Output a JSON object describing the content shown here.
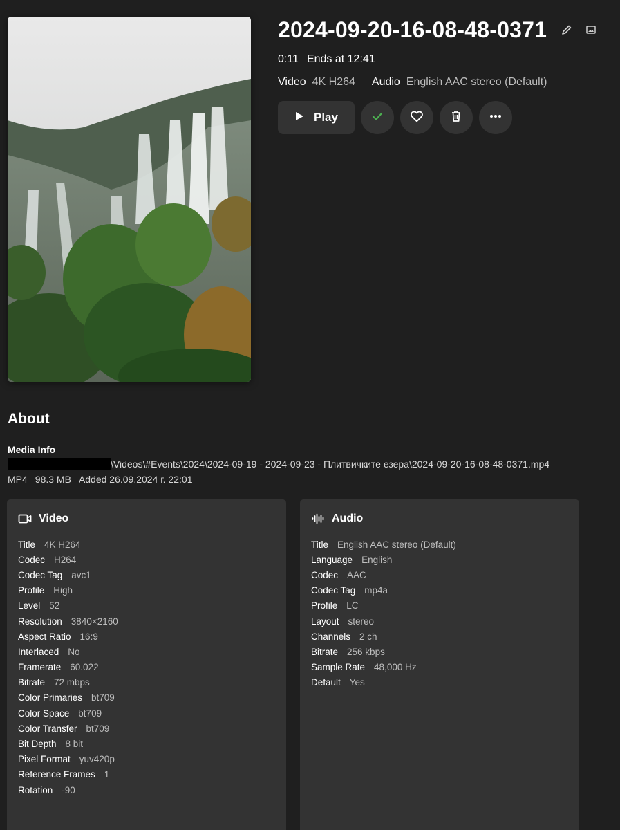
{
  "item": {
    "title": "2024-09-20-16-08-48-0371",
    "duration": "0:11",
    "ends_at": "Ends at 12:41",
    "video_label": "Video",
    "video_value": "4K H264",
    "audio_label": "Audio",
    "audio_value": "English AAC stereo (Default)"
  },
  "actions": {
    "play_label": "Play"
  },
  "icons": {
    "edit": "pencil-icon",
    "image": "image-icon",
    "play": "play-icon",
    "played": "check-icon",
    "favorite": "heart-icon",
    "delete": "trash-icon",
    "more": "more-icon",
    "video": "video-camera-icon",
    "audio": "audio-waveform-icon"
  },
  "colors": {
    "background": "#1f1f1f",
    "surface": "#333333",
    "check": "#4caf50",
    "muted_text": "#bdbdbd"
  },
  "about": {
    "title": "About",
    "media_info_heading": "Media Info",
    "path": "\\Videos\\#Events\\2024\\2024-09-19 - 2024-09-23 - Плитвичките езера\\2024-09-20-16-08-48-0371.mp4",
    "container": "MP4",
    "size": "98.3 MB",
    "added": "Added 26.09.2024 г. 22:01"
  },
  "video_card": {
    "heading": "Video",
    "rows": [
      {
        "k": "Title",
        "v": "4K H264"
      },
      {
        "k": "Codec",
        "v": "H264"
      },
      {
        "k": "Codec Tag",
        "v": "avc1"
      },
      {
        "k": "Profile",
        "v": "High"
      },
      {
        "k": "Level",
        "v": "52"
      },
      {
        "k": "Resolution",
        "v": "3840×2160"
      },
      {
        "k": "Aspect Ratio",
        "v": "16:9"
      },
      {
        "k": "Interlaced",
        "v": "No"
      },
      {
        "k": "Framerate",
        "v": "60.022"
      },
      {
        "k": "Bitrate",
        "v": "72 mbps"
      },
      {
        "k": "Color Primaries",
        "v": "bt709"
      },
      {
        "k": "Color Space",
        "v": "bt709"
      },
      {
        "k": "Color Transfer",
        "v": "bt709"
      },
      {
        "k": "Bit Depth",
        "v": "8 bit"
      },
      {
        "k": "Pixel Format",
        "v": "yuv420p"
      },
      {
        "k": "Reference Frames",
        "v": "1"
      },
      {
        "k": "Rotation",
        "v": "-90"
      }
    ]
  },
  "audio_card": {
    "heading": "Audio",
    "rows": [
      {
        "k": "Title",
        "v": "English AAC stereo (Default)"
      },
      {
        "k": "Language",
        "v": "English"
      },
      {
        "k": "Codec",
        "v": "AAC"
      },
      {
        "k": "Codec Tag",
        "v": "mp4a"
      },
      {
        "k": "Profile",
        "v": "LC"
      },
      {
        "k": "Layout",
        "v": "stereo"
      },
      {
        "k": "Channels",
        "v": "2 ch"
      },
      {
        "k": "Bitrate",
        "v": "256 kbps"
      },
      {
        "k": "Sample Rate",
        "v": "48,000 Hz"
      },
      {
        "k": "Default",
        "v": "Yes"
      }
    ]
  }
}
